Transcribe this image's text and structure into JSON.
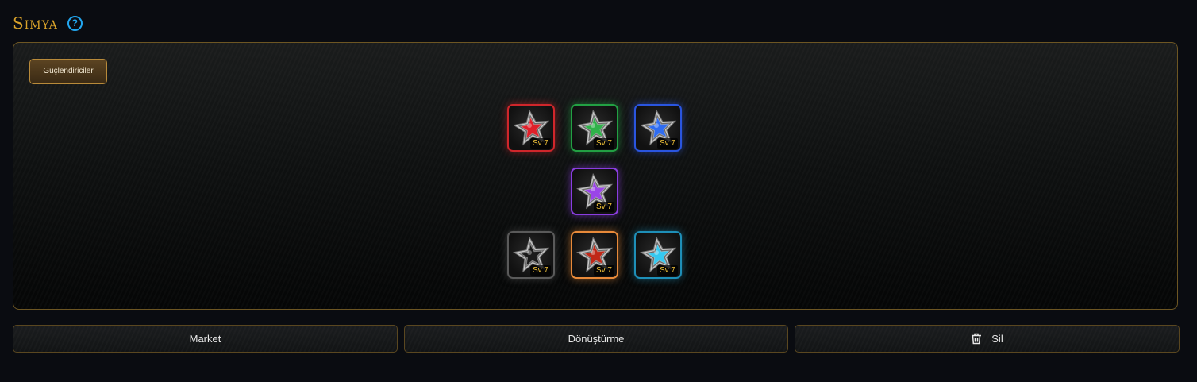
{
  "title": "Simya",
  "help_glyph": "?",
  "category_button": "Güçlendiriciler",
  "slots": [
    {
      "color": "#d0262b",
      "gem": "#e0202a",
      "level": "Sv 7"
    },
    {
      "color": "#22a043",
      "gem": "#2fb24a",
      "level": "Sv 7"
    },
    {
      "color": "#2a55e0",
      "gem": "#2f6cf0",
      "level": "Sv 7"
    },
    {
      "color": "#8a3de0",
      "gem": "#9a45e8",
      "level": "Sv 7"
    },
    {
      "color": "#5a5a5a",
      "gem": "#1a1a1a",
      "level": "Sv 7"
    },
    {
      "color": "#e88a3a",
      "gem": "#c02818",
      "level": "Sv 7"
    },
    {
      "color": "#1e8fb8",
      "gem": "#35c8f0",
      "level": "Sv 7"
    }
  ],
  "buttons": {
    "market": "Market",
    "transform": "Dönüştürme",
    "delete": "Sil"
  },
  "icons": {
    "help": "question-circle-icon",
    "delete": "trash-icon",
    "gem": "star-gem-icon"
  }
}
